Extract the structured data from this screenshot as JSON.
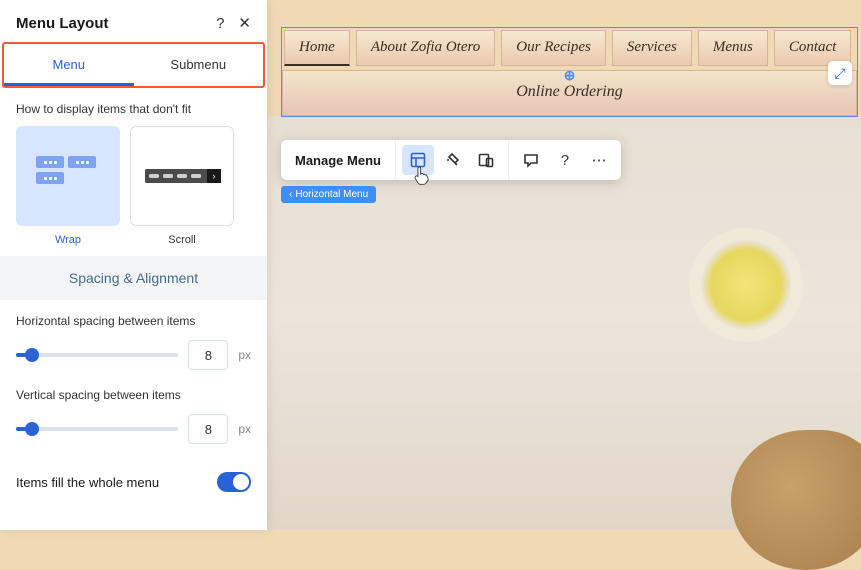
{
  "panel": {
    "title": "Menu Layout",
    "help_icon": "?",
    "close_icon": "✕",
    "tabs": {
      "menu": "Menu",
      "submenu": "Submenu"
    },
    "display_label": "How to display items that don't fit",
    "options": {
      "wrap": "Wrap",
      "scroll": "Scroll"
    },
    "section_spacing": "Spacing & Alignment",
    "h_spacing_label": "Horizontal spacing between items",
    "h_spacing_value": "8",
    "v_spacing_label": "Vertical spacing between items",
    "v_spacing_value": "8",
    "unit": "px",
    "fill_label": "Items fill the whole menu"
  },
  "nav": {
    "items": [
      "Home",
      "About Zofia Otero",
      "Our Recipes",
      "Services",
      "Menus",
      "Contact"
    ],
    "overflow_item": "Online Ordering"
  },
  "toolbar": {
    "manage_label": "Manage Menu",
    "help_icon": "?",
    "more_icon": "⋯"
  },
  "breadcrumb": "Horizontal Menu"
}
